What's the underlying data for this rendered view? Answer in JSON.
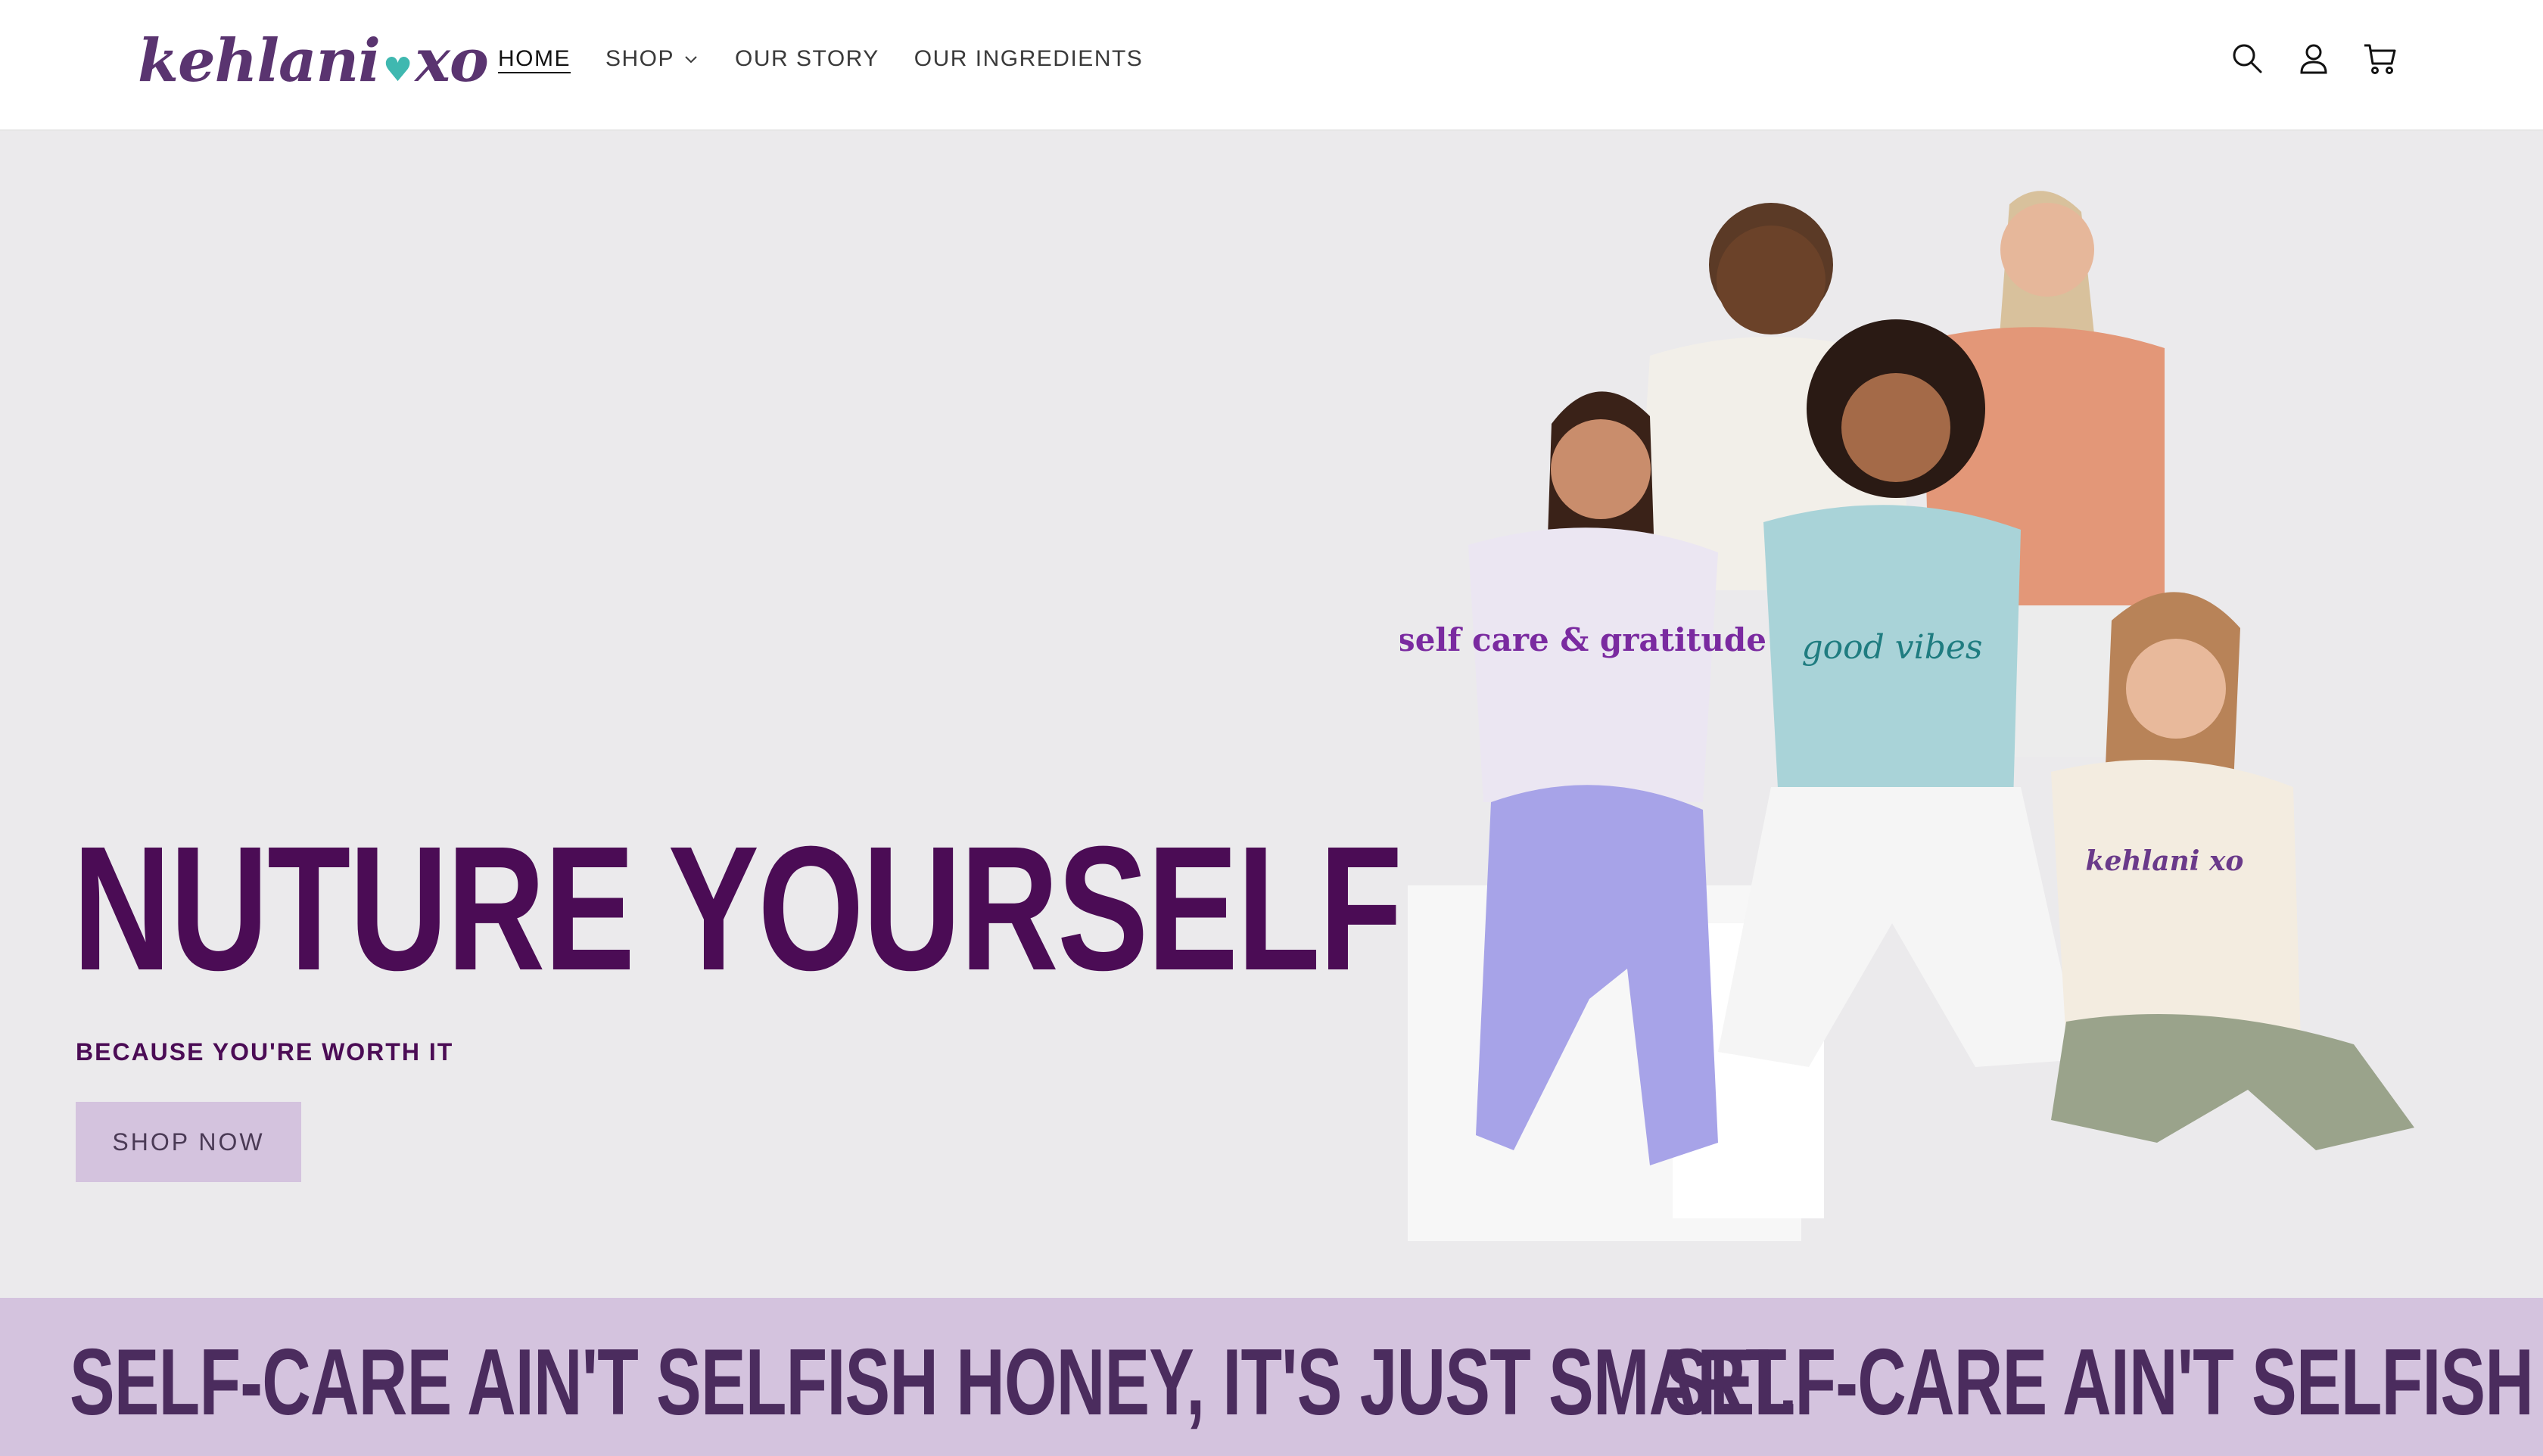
{
  "header": {
    "logo": {
      "left": "kehlani",
      "heart": "♥",
      "right": "xo"
    },
    "nav": [
      {
        "label": "HOME",
        "active": true
      },
      {
        "label": "SHOP",
        "has_dropdown": true
      },
      {
        "label": "OUR STORY"
      },
      {
        "label": "OUR INGREDIENTS"
      }
    ],
    "icons": [
      "search-icon",
      "account-icon",
      "cart-icon"
    ]
  },
  "hero": {
    "title": "NUTURE YOURSELF",
    "subtitle": "BECAUSE YOU'RE WORTH IT",
    "cta": "SHOP NOW",
    "shirt_texts": [
      "self care & gratitude",
      "good vibes",
      "kehlani xo"
    ]
  },
  "marquee": {
    "text": "SELF-CARE AIN'T SELFISH HONEY, IT'S JUST SMART."
  },
  "colors": {
    "brand_purple": "#4b0c55",
    "lilac": "#d4c3de",
    "background": "#ebeaec",
    "teal_accent": "#3fb8b0"
  }
}
